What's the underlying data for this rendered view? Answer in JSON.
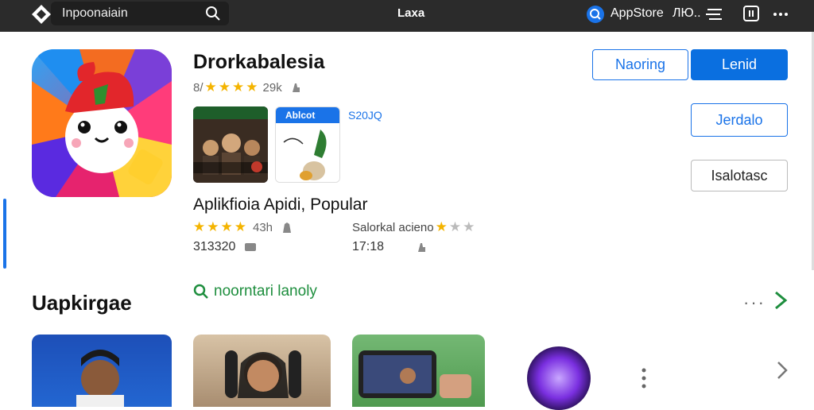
{
  "topbar": {
    "search_text": "Inpoonaiain",
    "center_title": "Laxa",
    "store_label": "AppStore",
    "store_extra": "ЛЮ.."
  },
  "app": {
    "title": "Drorkabalesia",
    "rating_prefix": "8/",
    "rating_value": "29k",
    "rating_stars": 4,
    "thumb2_header": "Ablcot",
    "side_label": "S20JQ"
  },
  "section": {
    "title": "Aplikfioia Apidi, Popular",
    "rating2_text": "43h",
    "rating2_stars": 4,
    "rating3_label": "Salorkal acieno",
    "count1": "313320",
    "count2": "17:18"
  },
  "buttons": {
    "outline": "Naoring",
    "primary": "Lenid",
    "secondary": "Jerdalo",
    "tertiary": "Isalotasc"
  },
  "bottom": {
    "title": "Uapkirgae",
    "link": "noorntari lanoly",
    "more": "···"
  },
  "colors": {
    "accent": "#1a73e8",
    "green": "#1e8e3e",
    "star": "#f4b400"
  }
}
